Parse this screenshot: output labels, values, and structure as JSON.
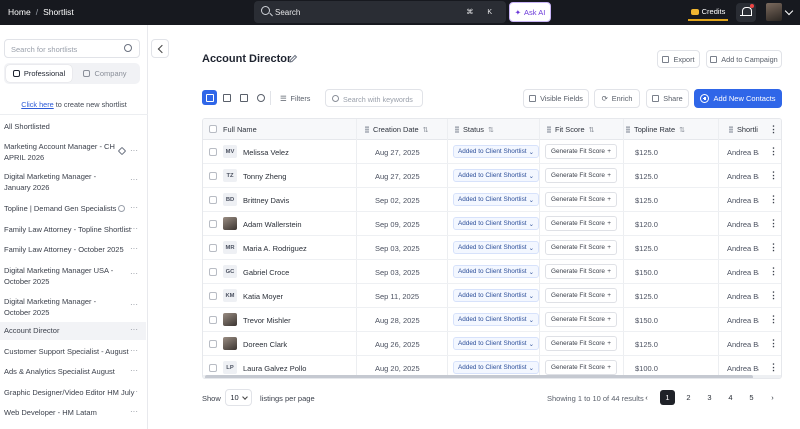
{
  "topbar": {
    "breadcrumb": [
      "Home",
      "Shortlist"
    ],
    "breadcrumb_sep": "/",
    "search_placeholder": "Search",
    "search_shortcut": "⌘ K",
    "ask_ai_label": "Ask AI",
    "credits_label": "Credits"
  },
  "sidebar": {
    "search_placeholder": "Search for shortlists",
    "tabs": [
      "Professional",
      "Company"
    ],
    "create_link": "Click here",
    "create_text": " to create new shortlist",
    "items": [
      {
        "label": "All Shortlisted"
      },
      {
        "label": "Marketing Account Manager - CH APRIL 2026"
      },
      {
        "label": "Digital Marketing Manager - January 2026"
      },
      {
        "label": "Topline | Demand Gen Specialists"
      },
      {
        "label": "Family Law Attorney - Topline Shortlist"
      },
      {
        "label": "Family Law Attorney - October 2025"
      },
      {
        "label": "Digital Marketing Manager USA - October 2025"
      },
      {
        "label": "Digital Marketing Manager - October 2025"
      },
      {
        "label": "Account Director"
      },
      {
        "label": "Customer Support Specialist - August"
      },
      {
        "label": "Ads & Analytics Specialist August"
      },
      {
        "label": "Graphic Designer/Video Editor HM July"
      },
      {
        "label": "Web Developer - HM Latam"
      }
    ],
    "more": "···"
  },
  "header": {
    "title": "Account Director",
    "export_label": "Export",
    "campaign_label": "Add to Campaign"
  },
  "toolbar": {
    "filters_label": "Filters",
    "keyword_placeholder": "Search with keywords",
    "visible_fields_label": "Visible Fields",
    "enrich_label": "Enrich",
    "share_label": "Share",
    "add_contacts_label": "Add New Contacts"
  },
  "table": {
    "columns": [
      "Full Name",
      "Creation Date",
      "Status",
      "Fit Score",
      "Topline Rate",
      "Shortli"
    ],
    "status_label": "Added to Client Shortlist",
    "fit_label": "Generate Fit Score",
    "rows": [
      {
        "initials": "MV",
        "name": "Melissa Velez",
        "date": "Aug 27, 2025",
        "rate": "$125.0",
        "shortlister": "Andrea Ba"
      },
      {
        "initials": "TZ",
        "name": "Tonny Zheng",
        "date": "Aug 27, 2025",
        "rate": "$125.0",
        "shortlister": "Andrea Ba"
      },
      {
        "initials": "BD",
        "name": "Brittney Davis",
        "date": "Sep 02, 2025",
        "rate": "$125.0",
        "shortlister": "Andrea Ba"
      },
      {
        "initials": "",
        "name": "Adam Wallerstein",
        "date": "Sep 09, 2025",
        "rate": "$120.0",
        "shortlister": "Andrea Ba"
      },
      {
        "initials": "MR",
        "name": "Maria A. Rodriguez",
        "date": "Sep 03, 2025",
        "rate": "$125.0",
        "shortlister": "Andrea Ba"
      },
      {
        "initials": "GC",
        "name": "Gabriel Croce",
        "date": "Sep 03, 2025",
        "rate": "$150.0",
        "shortlister": "Andrea Ba"
      },
      {
        "initials": "KM",
        "name": "Katia Moyer",
        "date": "Sep 11, 2025",
        "rate": "$125.0",
        "shortlister": "Andrea Ba"
      },
      {
        "initials": "",
        "name": "Trevor Mishler",
        "date": "Aug 28, 2025",
        "rate": "$150.0",
        "shortlister": "Andrea Ba"
      },
      {
        "initials": "",
        "name": "Doreen Clark",
        "date": "Aug 26, 2025",
        "rate": "$125.0",
        "shortlister": "Andrea Ba"
      },
      {
        "initials": "LP",
        "name": "Laura  Galvez Pollo",
        "date": "Aug 20, 2025",
        "rate": "$100.0",
        "shortlister": "Andrea Ba"
      }
    ]
  },
  "footer": {
    "show_label": "Show",
    "per_page": "10",
    "per_page_suffix": "listings per page",
    "showing_text": "Showing 1 to 10 of 44 results",
    "pages": [
      "1",
      "2",
      "3",
      "4",
      "5"
    ],
    "prev": "‹",
    "next": "›"
  },
  "colors": {
    "accent": "#2f66e8",
    "topbar": "#17191f",
    "credits": "#e0a41b",
    "ask_ai": "#6b39d9"
  }
}
